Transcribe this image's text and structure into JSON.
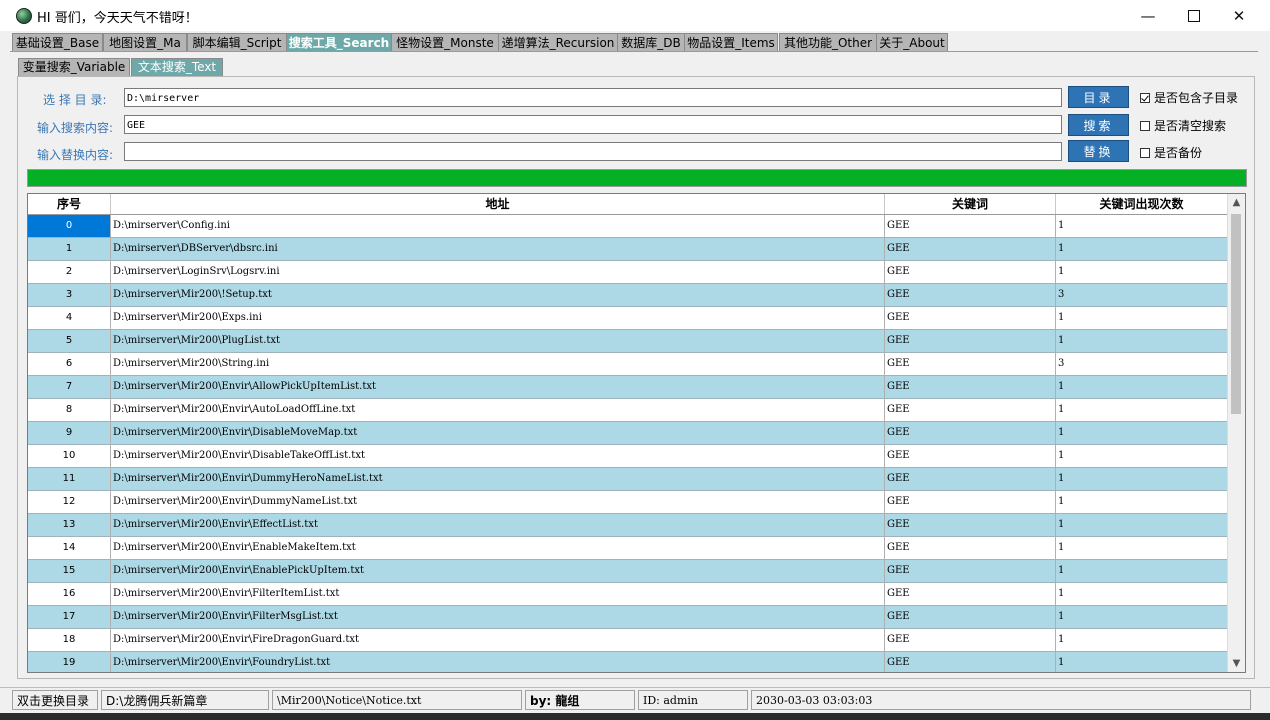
{
  "window": {
    "title": "HI 哥们，今天天气不错呀！",
    "minimize_glyph": "—",
    "close_glyph": "✕"
  },
  "main_tabs": [
    {
      "label": "基础设置_Base"
    },
    {
      "label": "地图设置_Ma"
    },
    {
      "label": "脚本编辑_Script"
    },
    {
      "label": "搜索工具_Search"
    },
    {
      "label": "怪物设置_Monste"
    },
    {
      "label": "递增算法_Recursion"
    },
    {
      "label": "数据库_DB"
    },
    {
      "label": "物品设置_Items"
    },
    {
      "label": "其他功能_Other"
    },
    {
      "label": "关于_About"
    }
  ],
  "sub_tabs": [
    {
      "label": "变量搜索_Variable"
    },
    {
      "label": "文本搜索_Text"
    }
  ],
  "form": {
    "dir_label": "选 择 目 录:",
    "dir_value": "D:\\mirserver",
    "search_label": "输入搜索内容:",
    "search_value": "GEE",
    "replace_label": "输入替换内容:",
    "replace_value": "",
    "dir_button": "目录",
    "search_button": "搜索",
    "replace_button": "替换",
    "include_subdirs": "是否包含子目录",
    "clear_search": "是否清空搜索",
    "backup": "是否备份"
  },
  "progress": 1.0,
  "colors": {
    "accent_tab": "#6fa8a8",
    "button": "#2e74b5",
    "progress": "#06b025",
    "row_alt": "#add8e6",
    "selection": "#0078d7"
  },
  "grid": {
    "columns": [
      "序号",
      "地址",
      "关键词",
      "关键词出现次数"
    ],
    "rows": [
      {
        "idx": "0",
        "path": "D:\\mirserver\\Config.ini",
        "kw": "GEE",
        "count": "1"
      },
      {
        "idx": "1",
        "path": "D:\\mirserver\\DBServer\\dbsrc.ini",
        "kw": "GEE",
        "count": "1"
      },
      {
        "idx": "2",
        "path": "D:\\mirserver\\LoginSrv\\Logsrv.ini",
        "kw": "GEE",
        "count": "1"
      },
      {
        "idx": "3",
        "path": "D:\\mirserver\\Mir200\\!Setup.txt",
        "kw": "GEE",
        "count": "3"
      },
      {
        "idx": "4",
        "path": "D:\\mirserver\\Mir200\\Exps.ini",
        "kw": "GEE",
        "count": "1"
      },
      {
        "idx": "5",
        "path": "D:\\mirserver\\Mir200\\PlugList.txt",
        "kw": "GEE",
        "count": "1"
      },
      {
        "idx": "6",
        "path": "D:\\mirserver\\Mir200\\String.ini",
        "kw": "GEE",
        "count": "3"
      },
      {
        "idx": "7",
        "path": "D:\\mirserver\\Mir200\\Envir\\AllowPickUpItemList.txt",
        "kw": "GEE",
        "count": "1"
      },
      {
        "idx": "8",
        "path": "D:\\mirserver\\Mir200\\Envir\\AutoLoadOffLine.txt",
        "kw": "GEE",
        "count": "1"
      },
      {
        "idx": "9",
        "path": "D:\\mirserver\\Mir200\\Envir\\DisableMoveMap.txt",
        "kw": "GEE",
        "count": "1"
      },
      {
        "idx": "10",
        "path": "D:\\mirserver\\Mir200\\Envir\\DisableTakeOffList.txt",
        "kw": "GEE",
        "count": "1"
      },
      {
        "idx": "11",
        "path": "D:\\mirserver\\Mir200\\Envir\\DummyHeroNameList.txt",
        "kw": "GEE",
        "count": "1"
      },
      {
        "idx": "12",
        "path": "D:\\mirserver\\Mir200\\Envir\\DummyNameList.txt",
        "kw": "GEE",
        "count": "1"
      },
      {
        "idx": "13",
        "path": "D:\\mirserver\\Mir200\\Envir\\EffectList.txt",
        "kw": "GEE",
        "count": "1"
      },
      {
        "idx": "14",
        "path": "D:\\mirserver\\Mir200\\Envir\\EnableMakeItem.txt",
        "kw": "GEE",
        "count": "1"
      },
      {
        "idx": "15",
        "path": "D:\\mirserver\\Mir200\\Envir\\EnablePickUpItem.txt",
        "kw": "GEE",
        "count": "1"
      },
      {
        "idx": "16",
        "path": "D:\\mirserver\\Mir200\\Envir\\FilterItemList.txt",
        "kw": "GEE",
        "count": "1"
      },
      {
        "idx": "17",
        "path": "D:\\mirserver\\Mir200\\Envir\\FilterMsgList.txt",
        "kw": "GEE",
        "count": "1"
      },
      {
        "idx": "18",
        "path": "D:\\mirserver\\Mir200\\Envir\\FireDragonGuard.txt",
        "kw": "GEE",
        "count": "1"
      },
      {
        "idx": "19",
        "path": "D:\\mirserver\\Mir200\\Envir\\FoundryList.txt",
        "kw": "GEE",
        "count": "1"
      }
    ]
  },
  "statusbar": {
    "hint": "双击更换目录",
    "path": "D:\\龙腾佣兵新篇章",
    "file": "\\Mir200\\Notice\\Notice.txt",
    "by": "by: 龍组",
    "id": "ID: admin",
    "time": "2030-03-03 03:03:03"
  }
}
